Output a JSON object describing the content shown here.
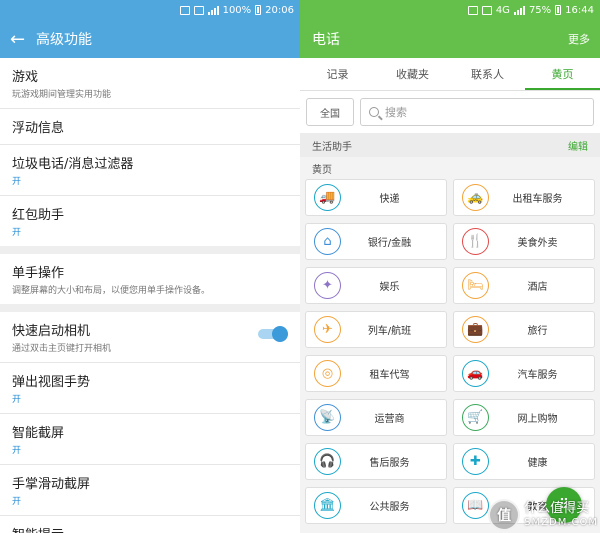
{
  "left": {
    "status": {
      "battery": "100%",
      "time": "20:06"
    },
    "appbar": {
      "back": "←",
      "title": "高级功能"
    },
    "items": [
      {
        "title": "游戏",
        "sub": "玩游戏期间管理实用功能"
      },
      {
        "title": "浮动信息",
        "sub": ""
      },
      {
        "title": "垃圾电话/消息过滤器",
        "sub": "开"
      },
      {
        "title": "红包助手",
        "sub": "开"
      },
      {
        "title": "单手操作",
        "sub": "调整屏幕的大小和布局，以便您用单手操作设备。"
      },
      {
        "title": "快速启动相机",
        "sub": "通过双击主页键打开相机"
      },
      {
        "title": "弹出视图手势",
        "sub": "开"
      },
      {
        "title": "智能截屏",
        "sub": "开"
      },
      {
        "title": "手掌滑动截屏",
        "sub": "开"
      },
      {
        "title": "智能提示",
        "sub": ""
      }
    ],
    "toggle_on": true
  },
  "right": {
    "status": {
      "network": "4G",
      "battery": "75%",
      "time": "16:44"
    },
    "appbar": {
      "title": "电话",
      "more": "更多"
    },
    "tabs": [
      {
        "label": "记录",
        "active": false
      },
      {
        "label": "收藏夹",
        "active": false
      },
      {
        "label": "联系人",
        "active": false
      },
      {
        "label": "黄页",
        "active": true
      }
    ],
    "region_button": "全国",
    "search_placeholder": "搜索",
    "section_assistant": "生活助手",
    "edit": "编辑",
    "section_yellow": "黄页",
    "tiles": [
      {
        "label": "快递",
        "icon": "truck-icon",
        "glyph": "🚚",
        "color": "c-teal"
      },
      {
        "label": "出租车服务",
        "icon": "taxi-icon",
        "glyph": "🚕",
        "color": "c-orange"
      },
      {
        "label": "银行/金融",
        "icon": "bank-icon",
        "glyph": "⌂",
        "color": "c-blue"
      },
      {
        "label": "美食外卖",
        "icon": "cutlery-icon",
        "glyph": "🍴",
        "color": "c-red"
      },
      {
        "label": "娱乐",
        "icon": "ticket-icon",
        "glyph": "✦",
        "color": "c-purple"
      },
      {
        "label": "酒店",
        "icon": "bed-icon",
        "glyph": "🛏",
        "color": "c-orange"
      },
      {
        "label": "列车/航班",
        "icon": "plane-icon",
        "glyph": "✈",
        "color": "c-orange"
      },
      {
        "label": "旅行",
        "icon": "suitcase-icon",
        "glyph": "💼",
        "color": "c-orange"
      },
      {
        "label": "租车代驾",
        "icon": "steering-wheel-icon",
        "glyph": "◎",
        "color": "c-orange"
      },
      {
        "label": "汽车服务",
        "icon": "car-icon",
        "glyph": "🚗",
        "color": "c-teal"
      },
      {
        "label": "运营商",
        "icon": "satellite-icon",
        "glyph": "📡",
        "color": "c-blue"
      },
      {
        "label": "网上购物",
        "icon": "cart-icon",
        "glyph": "🛒",
        "color": "c-green"
      },
      {
        "label": "售后服务",
        "icon": "headset-icon",
        "glyph": "🎧",
        "color": "c-teal"
      },
      {
        "label": "健康",
        "icon": "first-aid-icon",
        "glyph": "✚",
        "color": "c-teal"
      },
      {
        "label": "公共服务",
        "icon": "government-icon",
        "glyph": "🏛",
        "color": "c-teal"
      },
      {
        "label": "教育",
        "icon": "book-icon",
        "glyph": "📖",
        "color": "c-teal"
      }
    ],
    "fab_glyph": "⠿"
  },
  "watermark": {
    "badge": "值",
    "line1": "什么值得买",
    "line2": "SMZDM.COM"
  }
}
